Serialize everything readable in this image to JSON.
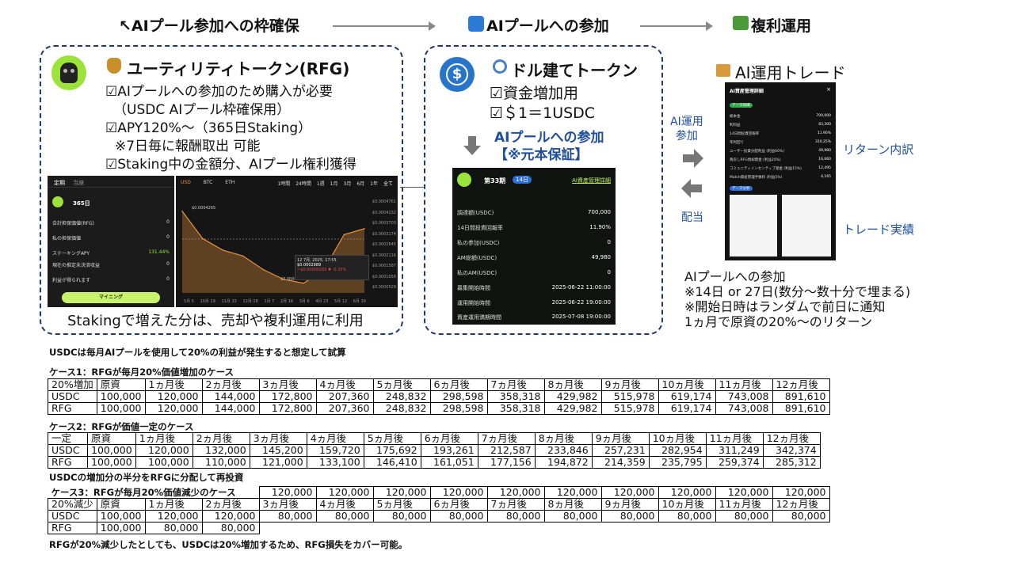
{
  "header": {
    "step1": "↖AIプール参加への枠確保",
    "step2": "AIプールへの参加",
    "step3": "複利運用"
  },
  "rfg_box": {
    "title": "ユーティリティトークン(RFG)",
    "lines": [
      "☑AIプールへの参加のため購入が必要",
      "（USDC AIプール枠確保用）",
      "☑APY120%～（365日Staking）",
      "※7日毎に報酬取出 可能",
      "☑Staking中の金額分、AIプール権利獲得"
    ],
    "footer": "Stakingで増えた分は、売却や複利運用に利用"
  },
  "staking_app": {
    "tabs": [
      "定期",
      "当座"
    ],
    "period": "365日",
    "rows": [
      {
        "label": "合計担保価値(RFG)",
        "value": "0"
      },
      {
        "label": "私の担保価値",
        "value": "0"
      },
      {
        "label": "ステーキングAPY",
        "value": "131.44%"
      },
      {
        "label": "現在の推定未決済収益",
        "value": "0"
      },
      {
        "label": "利益が得られます",
        "value": "0"
      }
    ],
    "button": "マイニング"
  },
  "price_chart": {
    "tabs": [
      "USD",
      "BTC",
      "ETH"
    ],
    "ranges": [
      "1時間",
      "24時間",
      "1週",
      "1月",
      "3月",
      "6月",
      "1年",
      "全て"
    ],
    "high_label": "$0.0004265",
    "low_label": "$0.00000265",
    "tooltip_date": "12 7月, 2025, 17:55",
    "tooltip_price": "$0.0002989",
    "tooltip_change": "~$0.00000265 ▼ -0.35%",
    "y_ticks": [
      "$0.0004761",
      "$0.0004232",
      "$0.0003703",
      "$0.0003174",
      "$0.0002645",
      "$0.0002116",
      "$0.0001587",
      "$0.0001058",
      "$0.0000529"
    ],
    "x_ticks": [
      "5月 5",
      "10月 19",
      "11月 23",
      "12月 28",
      "1月 7",
      "2月 16",
      "3月 6",
      "4月 23",
      "5月 12",
      "6月 16"
    ],
    "chart_data": {
      "type": "area",
      "x": [
        "5月 5",
        "10月 19",
        "11月 23",
        "12月 28",
        "1月 7",
        "2月 16",
        "3月 6",
        "4月 23",
        "5月 12",
        "6月 16"
      ],
      "values": [
        0.00042,
        0.00028,
        0.00022,
        0.00019,
        0.00012,
        7e-05,
        5e-05,
        0.00012,
        0.0003,
        0.00033
      ],
      "color": "#e8953b"
    }
  },
  "usdc_box": {
    "title": "ドル建てトークン",
    "lines": [
      "☑資金増加用",
      "☑＄1＝1USDC"
    ],
    "join_title": "AIプールへの参加",
    "join_note": "【※元本保証】"
  },
  "pool_app": {
    "period": "第33期",
    "badge": "14日",
    "link": "AI資産管理詳細",
    "rows": [
      {
        "label": "調達額(USDC)",
        "value": "700,000"
      },
      {
        "label": "14日間投資回報率",
        "value": "11.90%"
      },
      {
        "label": "私の参加(USDC)",
        "value": "0"
      },
      {
        "label": "AM総額(USDC)",
        "value": "49,980"
      },
      {
        "label": "私のAM(USDC)",
        "value": "0"
      },
      {
        "label": "募集開始時間",
        "value": "2025-06-22 11:00:00"
      },
      {
        "label": "運用開始時間",
        "value": "2025-06-22 19:00:00"
      },
      {
        "label": "資産運用満期時間",
        "value": "2025-07-08 19:00:00"
      }
    ]
  },
  "ai_trade": {
    "title": "AI運用トレード",
    "arrow_right_label": "AI運用\n参加",
    "arrow_left_label": "配当",
    "return_label": "リターン内訳",
    "trade_label": "トレード実績",
    "panel_title": "AI資産管理詳細",
    "panel_section1": "データ詳細",
    "panel_section2": "データ分析",
    "panel_rows": [
      {
        "label": "総本金",
        "value": "700,000"
      },
      {
        "label": "利料益",
        "value": "83,300"
      },
      {
        "label": "14日間投資回報率",
        "value": "11.90%"
      },
      {
        "label": "年利回り",
        "value": "310.25%"
      },
      {
        "label": "ユーザー投資分配利益 (利益60%)",
        "value": "49,980"
      },
      {
        "label": "買戻しRFG焼却資金 (利益20%)",
        "value": "16,660"
      },
      {
        "label": "コミュニティインセンティブ基金 (利益15%)",
        "value": "12,495"
      },
      {
        "label": "Match資産管理手数料 (利益5%)",
        "value": "4,165"
      }
    ],
    "notes": [
      "AIプールへの参加",
      "※14日 or 27日(数分～数十分で埋まる)",
      "※開始日時はランダムで前日に通知",
      "1ヵ月で原資の20%～のリターン"
    ]
  },
  "calc": {
    "intro": "USDCは毎月AIプールを使用して20%の利益が発生すると想定して試算",
    "months": [
      "原資",
      "1ヵ月後",
      "2ヵ月後",
      "3ヵ月後",
      "4ヵ月後",
      "5ヵ月後",
      "6ヵ月後",
      "7ヵ月後",
      "8ヵ月後",
      "9ヵ月後",
      "10ヵ月後",
      "11ヵ月後",
      "12ヵ月後"
    ],
    "case1": {
      "title": "ケース1：RFGが毎月20%価値増加のケース",
      "corner": "20%増加",
      "rows": [
        {
          "label": "USDC",
          "values": [
            "100,000",
            "120,000",
            "144,000",
            "172,800",
            "207,360",
            "248,832",
            "298,598",
            "358,318",
            "429,982",
            "515,978",
            "619,174",
            "743,008",
            "891,610"
          ]
        },
        {
          "label": "RFG",
          "values": [
            "100,000",
            "120,000",
            "144,000",
            "172,800",
            "207,360",
            "248,832",
            "298,598",
            "358,318",
            "429,982",
            "515,978",
            "619,174",
            "743,008",
            "891,610"
          ]
        }
      ]
    },
    "case2": {
      "title": "ケース2：RFGが価値一定のケース",
      "corner": "一定",
      "rows": [
        {
          "label": "USDC",
          "values": [
            "100,000",
            "120,000",
            "132,000",
            "145,200",
            "159,720",
            "175,692",
            "193,261",
            "212,587",
            "233,846",
            "257,231",
            "282,954",
            "311,249",
            "342,374"
          ]
        },
        {
          "label": "RFG",
          "values": [
            "100,000",
            "100,000",
            "110,000",
            "121,000",
            "133,100",
            "146,410",
            "161,051",
            "177,156",
            "194,872",
            "214,359",
            "235,795",
            "259,374",
            "285,312"
          ]
        }
      ],
      "note": "USDCの増加分の半分をRFGに分配して再投資"
    },
    "case3": {
      "title": "ケース3：RFGが毎月20%価値減少のケース",
      "corner": "20%減少",
      "head_values": [
        "120,000",
        "120,000",
        "120,000",
        "120,000",
        "120,000",
        "120,000",
        "120,000",
        "120,000",
        "120,000",
        "120,000"
      ],
      "rows": [
        {
          "label": "USDC",
          "values": [
            "100,000",
            "120,000",
            "120,000",
            "80,000",
            "80,000",
            "80,000",
            "80,000",
            "80,000",
            "80,000",
            "80,000",
            "80,000",
            "80,000",
            "80,000"
          ]
        },
        {
          "label": "RFG",
          "values": [
            "100,000",
            "80,000",
            "80,000"
          ]
        }
      ],
      "note": "RFGが20%減少したとしても、USDCは20%増加するため、RFG損失をカバー可能。"
    }
  }
}
